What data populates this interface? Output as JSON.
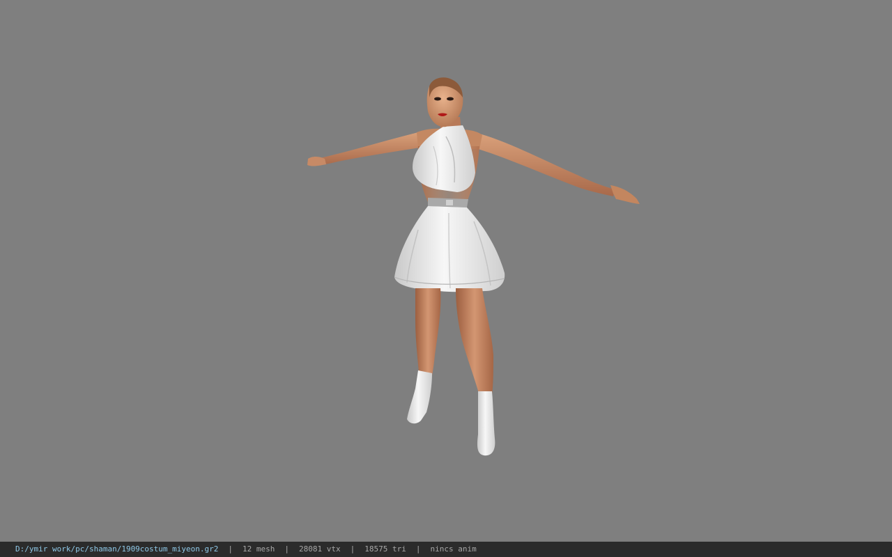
{
  "statusbar": {
    "file_path": "D:/ymir work/pc/shaman/1909costum_miyeon.gr2",
    "separator": "|",
    "mesh_count": "12 mesh",
    "vertex_count": "28081 vtx",
    "triangle_count": "18575 tri",
    "anim_status": "nincs anim"
  },
  "colors": {
    "background": "#7f7f7f",
    "statusbar_bg": "#2b2b2b",
    "path_text": "#8fc9e8",
    "status_text": "#a8a8a8",
    "skin": "#c98a64",
    "dress": "#eeeeee"
  }
}
